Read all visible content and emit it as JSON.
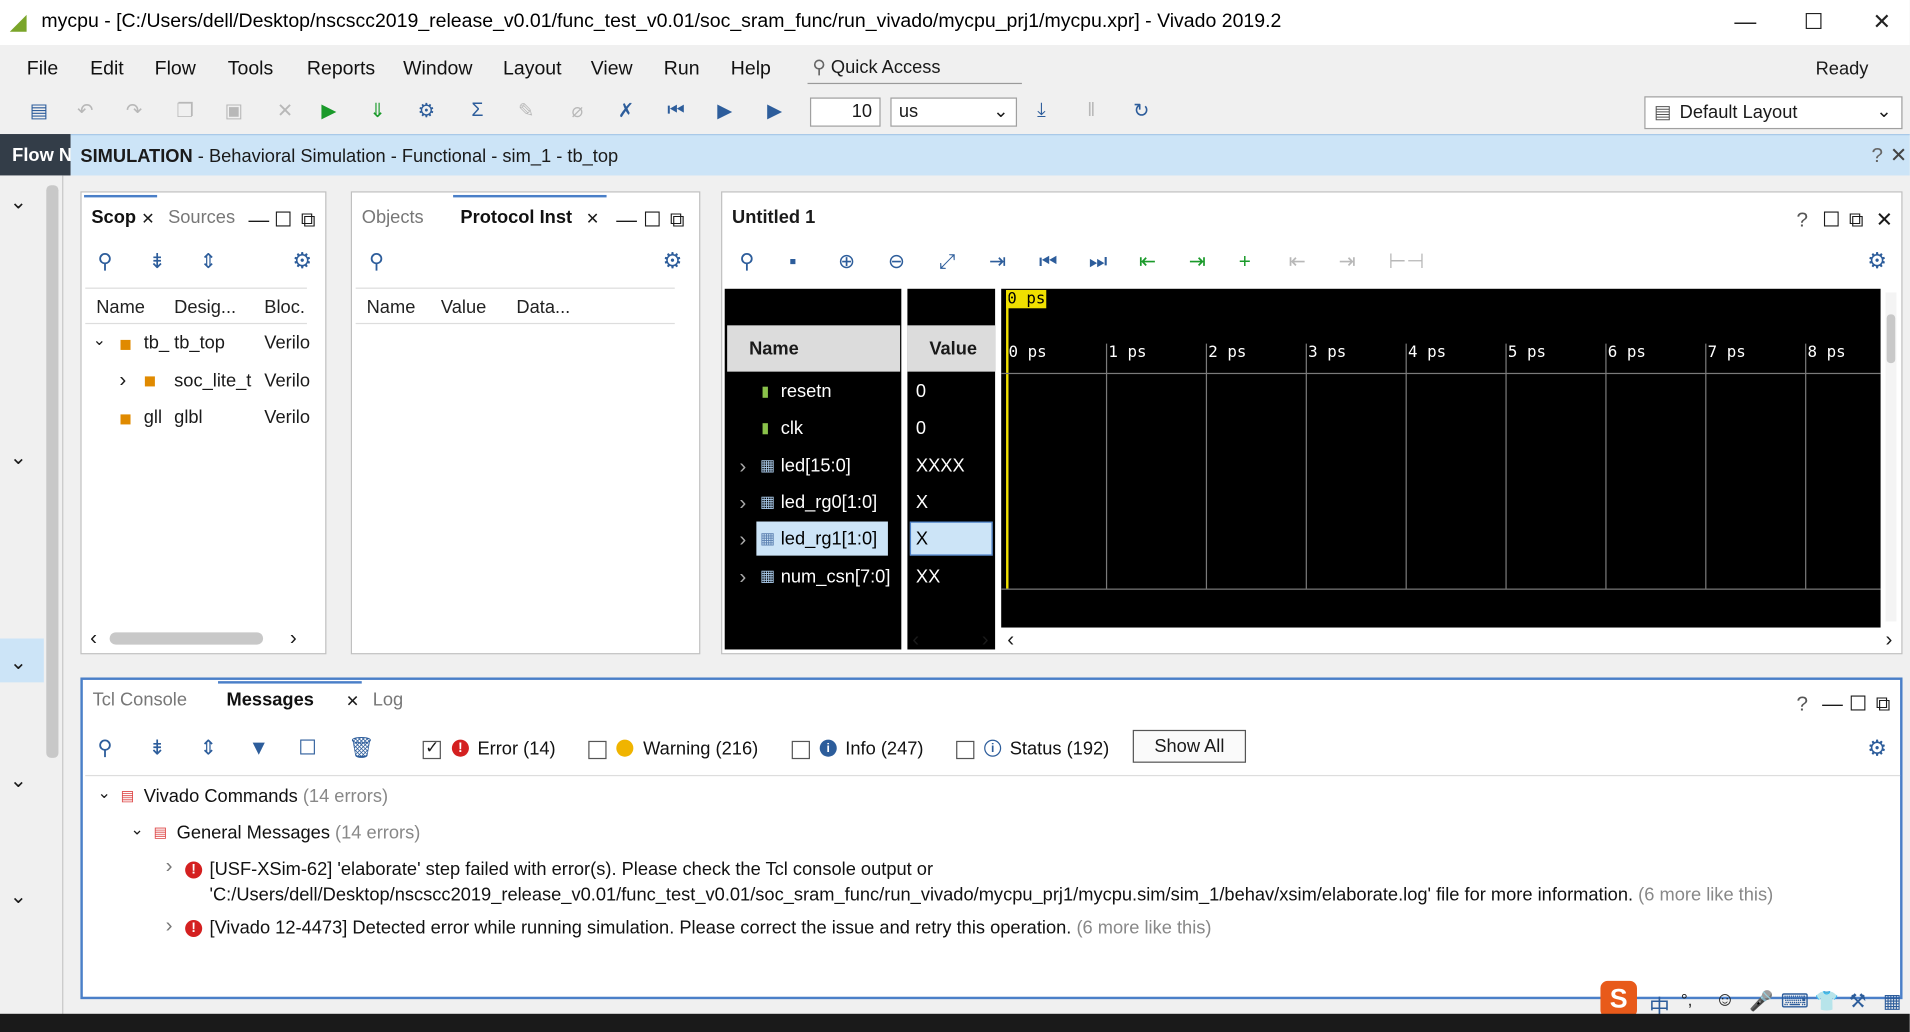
{
  "window": {
    "title": "mycpu - [C:/Users/dell/Desktop/nscscc2019_release_v0.01/func_test_v0.01/soc_sram_func/run_vivado/mycpu_prj1/mycpu.xpr] - Vivado 2019.2"
  },
  "menu": [
    "File",
    "Edit",
    "Flow",
    "Tools",
    "Reports",
    "Window",
    "Layout",
    "View",
    "Run",
    "Help"
  ],
  "quick_access": "Quick Access",
  "status": "Ready",
  "toolbar": {
    "time_value": "10",
    "time_unit": "us",
    "layout": "Default Layout"
  },
  "flow_tab": "Flow N",
  "sim_banner": {
    "bold": "SIMULATION",
    "text": " - Behavioral Simulation - Functional - sim_1 - tb_top"
  },
  "scope_panel": {
    "tabs": [
      "Scop",
      "Sources"
    ],
    "columns": [
      "Name",
      "Desig...",
      "Bloc."
    ],
    "rows": [
      {
        "name": "tb_",
        "design": "tb_top",
        "block": "Verilo"
      },
      {
        "name": "",
        "design": "soc_lite_t",
        "block": "Verilo"
      },
      {
        "name": "gll",
        "design": "glbl",
        "block": "Verilo"
      }
    ]
  },
  "objects_panel": {
    "tabs": [
      "Objects",
      "Protocol Inst"
    ],
    "columns": [
      "Name",
      "Value",
      "Data..."
    ]
  },
  "wave_panel": {
    "title": "Untitled 1",
    "cursor_label": "0 ps",
    "col_name": "Name",
    "col_value": "Value",
    "ticks": [
      "0 ps",
      "1 ps",
      "2 ps",
      "3 ps",
      "4 ps",
      "5 ps",
      "6 ps",
      "7 ps",
      "8 ps"
    ],
    "signals": [
      {
        "name": "resetn",
        "value": "0"
      },
      {
        "name": "clk",
        "value": "0"
      },
      {
        "name": "led[15:0]",
        "value": "XXXX"
      },
      {
        "name": "led_rg0[1:0]",
        "value": "X"
      },
      {
        "name": "led_rg1[1:0]",
        "value": "X"
      },
      {
        "name": "num_csn[7:0]",
        "value": "XX"
      }
    ]
  },
  "messages_panel": {
    "tabs": [
      "Tcl Console",
      "Messages",
      "Log"
    ],
    "filters": {
      "error": "Error (14)",
      "warning": "Warning (216)",
      "info": "Info (247)",
      "status": "Status (192)",
      "show_all": "Show All"
    },
    "tree": {
      "group1": "Vivado Commands",
      "group1_count": "(14 errors)",
      "group2": "General Messages",
      "group2_count": "(14 errors)",
      "msg1_line1": "[USF-XSim-62] 'elaborate' step failed with error(s). Please check the Tcl console output or",
      "msg1_line2": "'C:/Users/dell/Desktop/nscscc2019_release_v0.01/func_test_v0.01/soc_sram_func/run_vivado/mycpu_prj1/mycpu.sim/sim_1/behav/xsim/elaborate.log' file for more information.",
      "msg1_more": "(6 more like this)",
      "msg2": "[Vivado 12-4473] Detected error while running simulation. Please correct the issue and retry this operation.",
      "msg2_more": "(6 more like this)"
    }
  },
  "ime": {
    "mode": "中",
    "punct": "°,"
  }
}
